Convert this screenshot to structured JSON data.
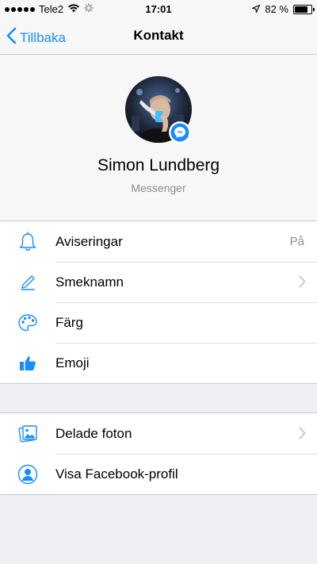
{
  "status_bar": {
    "carrier": "Tele2",
    "time": "17:01",
    "battery_percent": "82 %",
    "battery_level": 0.82,
    "icons": [
      "signal-dots-icon",
      "wifi-icon",
      "activity-spinner-icon",
      "location-arrow-icon",
      "battery-icon"
    ]
  },
  "nav": {
    "back_label": "Tillbaka",
    "title": "Kontakt"
  },
  "profile": {
    "name": "Simon Lundberg",
    "subtitle": "Messenger"
  },
  "settings": {
    "items": [
      {
        "label": "Aviseringar",
        "value": "På",
        "icon": "bell-icon"
      },
      {
        "label": "Smeknamn",
        "icon": "pencil-icon",
        "chevron": true
      },
      {
        "label": "Färg",
        "icon": "palette-icon"
      },
      {
        "label": "Emoji",
        "icon": "thumbs-up-icon"
      }
    ]
  },
  "more": {
    "items": [
      {
        "label": "Delade foton",
        "icon": "photos-icon",
        "chevron": true
      },
      {
        "label": "Visa Facebook-profil",
        "icon": "person-icon"
      }
    ]
  },
  "colors": {
    "accent": "#1a8cff",
    "background": "#efeff4"
  }
}
